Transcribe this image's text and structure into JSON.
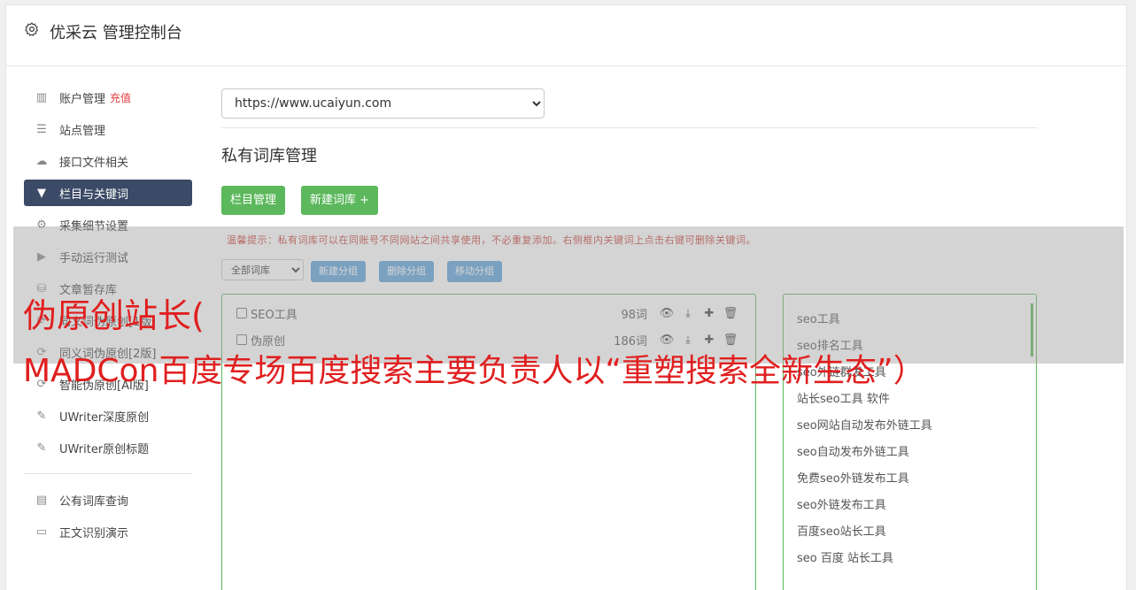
{
  "header": {
    "title": "优采云 管理控制台",
    "icon": "gear-icon"
  },
  "sidebar": {
    "items": [
      {
        "label": "账户管理",
        "badge": "充值",
        "icon": "bar-chart-icon"
      },
      {
        "label": "站点管理",
        "icon": "server-icon"
      },
      {
        "label": "接口文件相关",
        "icon": "cloud-upload-icon"
      },
      {
        "label": "栏目与关键词",
        "icon": "filter-icon",
        "active": true
      },
      {
        "label": "采集细节设置",
        "icon": "cogs-icon"
      },
      {
        "label": "手动运行测试",
        "icon": "play-icon"
      },
      {
        "label": "文章暂存库",
        "icon": "database-icon"
      },
      {
        "label": "同义词伪原创[1版",
        "icon": "refresh-icon"
      },
      {
        "label": "同义词伪原创[2版]",
        "icon": "refresh-icon"
      },
      {
        "label": "智能伪原创[AI版]",
        "icon": "refresh-icon"
      },
      {
        "label": "UWriter深度原创",
        "icon": "edit-icon"
      },
      {
        "label": "UWriter原创标题",
        "icon": "edit-icon"
      },
      {
        "label": "公有词库查询",
        "icon": "book-icon"
      },
      {
        "label": "正文识别演示",
        "icon": "monitor-icon"
      }
    ]
  },
  "main": {
    "site_select": "https://www.ucaiyun.com",
    "section_title": "私有词库管理",
    "buttons": {
      "column_manage": "栏目管理",
      "new_lib": "新建词库 +"
    },
    "tip": "温馨提示：私有词库可以在同账号不同网站之间共享使用，不必重复添加。右侧框内关键词上点击右键可删除关键词。",
    "group_select": "全部词库",
    "group_buttons": {
      "new": "新建分组",
      "delete": "删除分组",
      "move": "移动分组"
    },
    "libraries": [
      {
        "name": "SEO工具",
        "count": "98词"
      },
      {
        "name": "伪原创",
        "count": "186词"
      }
    ],
    "keywords": [
      "seo工具",
      "seo排名工具",
      "seo外链群发工具",
      "站长seo工具 软件",
      "seo网站自动发布外链工具",
      "seo自动发布外链工具",
      "免费seo外链发布工具",
      "seo外链发布工具",
      "百度seo站长工具",
      "seo 百度 站长工具"
    ]
  },
  "overlay": {
    "line1": "伪原创站长(",
    "line2": "MADCon百度专场百度搜索主要负责人以“重塑搜索全新生态”）"
  },
  "colors": {
    "green": "#5cb85c",
    "blue": "#5ea2dd",
    "active_nav": "#3b4a66",
    "overlay_red": "#e01f1f"
  }
}
